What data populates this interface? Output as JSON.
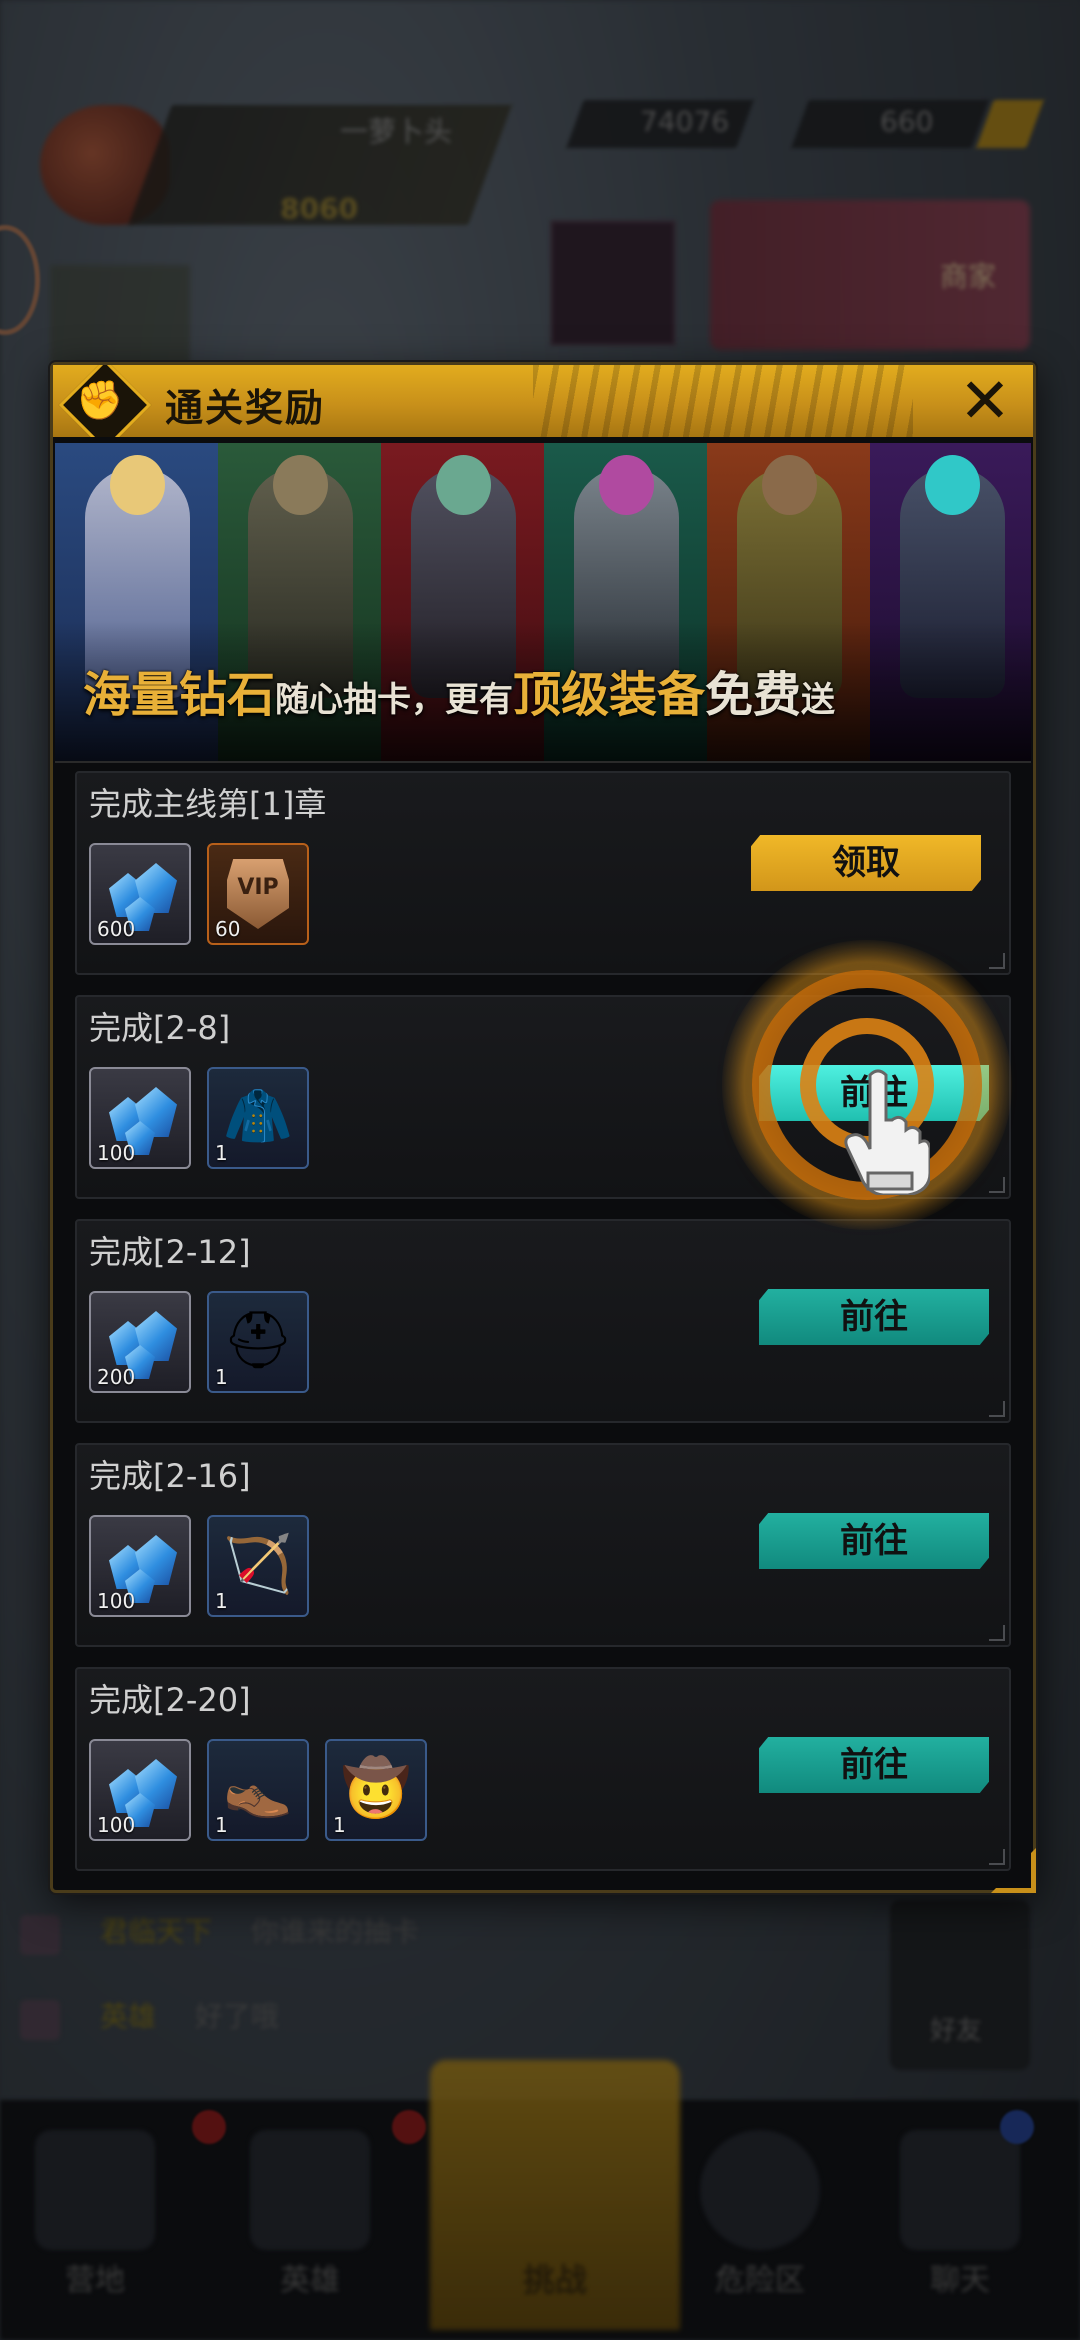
{
  "background": {
    "player_name": "一萝卜头",
    "player_level": "8060",
    "resource_1": "74076",
    "resource_2": "660",
    "event_label": "商家",
    "chat": [
      {
        "who": "君临天下",
        "msg": "你谁来的抽卡"
      },
      {
        "who": "英雄",
        "msg": "好了哦"
      }
    ],
    "side_button_label": "好友",
    "nav": [
      {
        "label": "营地"
      },
      {
        "label": "英雄"
      },
      {
        "label": "挑战"
      },
      {
        "label": "危险区"
      },
      {
        "label": "聊天"
      }
    ]
  },
  "modal": {
    "title": "通关奖励",
    "close_icon": "✕",
    "banner": {
      "part1": "海量钻石",
      "part2": "随心抽卡，更有",
      "part3": "顶级装备",
      "part4": "免费",
      "part5": "送"
    },
    "tasks": [
      {
        "title": "完成主线第[1]章",
        "items": [
          {
            "kind": "diamond",
            "icon": "diamond-icon",
            "count": "600"
          },
          {
            "kind": "vip",
            "icon": "vip-badge-icon",
            "count": "60",
            "label": "VIP"
          }
        ],
        "button": "领取",
        "button_state": "claim"
      },
      {
        "title": "完成[2-8]",
        "items": [
          {
            "kind": "diamond",
            "icon": "diamond-icon",
            "count": "100"
          },
          {
            "kind": "gear",
            "icon": "jacket-icon",
            "count": "1",
            "glyph": "🧥"
          }
        ],
        "button": "前往",
        "button_state": "go-highlight"
      },
      {
        "title": "完成[2-12]",
        "items": [
          {
            "kind": "diamond",
            "icon": "diamond-icon",
            "count": "200"
          },
          {
            "kind": "gear",
            "icon": "helmet-icon",
            "count": "1",
            "glyph": "⛑"
          }
        ],
        "button": "前往",
        "button_state": "go"
      },
      {
        "title": "完成[2-16]",
        "items": [
          {
            "kind": "diamond",
            "icon": "diamond-icon",
            "count": "100"
          },
          {
            "kind": "gear",
            "icon": "crossbow-icon",
            "count": "1",
            "glyph": "🏹"
          }
        ],
        "button": "前往",
        "button_state": "go"
      },
      {
        "title": "完成[2-20]",
        "items": [
          {
            "kind": "diamond",
            "icon": "diamond-icon",
            "count": "100"
          },
          {
            "kind": "gear",
            "icon": "boots-icon",
            "count": "1",
            "glyph": "👞"
          },
          {
            "kind": "gear",
            "icon": "hat-icon",
            "count": "1",
            "glyph": "🤠"
          }
        ],
        "button": "前往",
        "button_state": "go"
      }
    ]
  },
  "colors": {
    "header_gold": "#d8a01c",
    "claim_button": "#e0a820",
    "go_button": "#18a090",
    "go_button_active": "#40e8d8",
    "ring": "#d0800e"
  }
}
